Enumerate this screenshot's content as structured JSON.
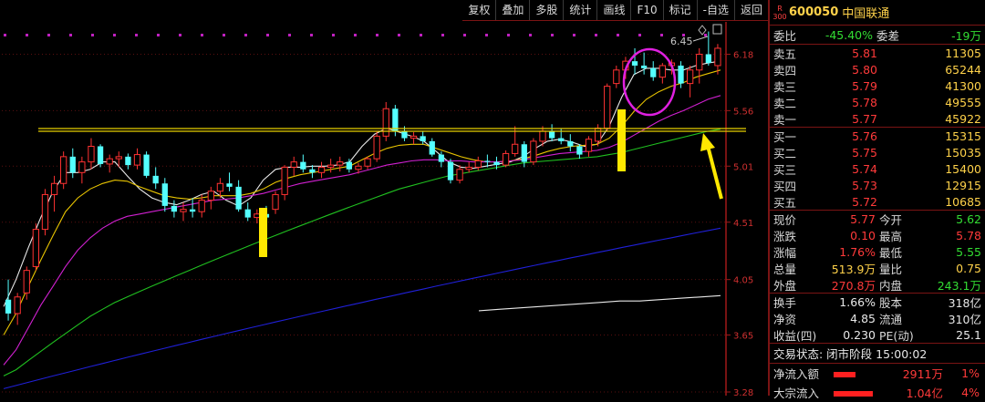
{
  "toolbar": {
    "buttons": [
      "复权",
      "叠加",
      "多股",
      "统计",
      "画线",
      "F10",
      "标记",
      "-自选",
      "返回"
    ]
  },
  "chart_data": {
    "type": "candlestick",
    "y_ticks": [
      "6.18",
      "5.56",
      "5.01",
      "4.51",
      "4.05",
      "3.65",
      "3.28"
    ],
    "peak_label": "6.45",
    "y_range": [
      3.28,
      6.5
    ],
    "candles": [
      {
        "o": 3.9,
        "h": 4.05,
        "l": 3.75,
        "c": 3.8
      },
      {
        "o": 3.8,
        "h": 3.95,
        "l": 3.72,
        "c": 3.92
      },
      {
        "o": 3.95,
        "h": 4.15,
        "l": 3.9,
        "c": 4.12
      },
      {
        "o": 4.15,
        "h": 4.5,
        "l": 4.12,
        "c": 4.45
      },
      {
        "o": 4.45,
        "h": 4.8,
        "l": 4.4,
        "c": 4.75
      },
      {
        "o": 4.75,
        "h": 4.92,
        "l": 4.6,
        "c": 4.85
      },
      {
        "o": 4.85,
        "h": 5.15,
        "l": 4.8,
        "c": 5.1
      },
      {
        "o": 5.1,
        "h": 5.18,
        "l": 4.9,
        "c": 4.95
      },
      {
        "o": 4.95,
        "h": 5.1,
        "l": 4.85,
        "c": 5.05
      },
      {
        "o": 5.05,
        "h": 5.28,
        "l": 4.98,
        "c": 5.2
      },
      {
        "o": 5.2,
        "h": 5.22,
        "l": 5.0,
        "c": 5.03
      },
      {
        "o": 5.03,
        "h": 5.12,
        "l": 4.95,
        "c": 5.08
      },
      {
        "o": 5.08,
        "h": 5.15,
        "l": 5.0,
        "c": 5.1
      },
      {
        "o": 5.1,
        "h": 5.13,
        "l": 4.98,
        "c": 5.02
      },
      {
        "o": 5.02,
        "h": 5.18,
        "l": 4.98,
        "c": 5.12
      },
      {
        "o": 5.12,
        "h": 5.15,
        "l": 4.9,
        "c": 4.92
      },
      {
        "o": 4.92,
        "h": 5.0,
        "l": 4.8,
        "c": 4.85
      },
      {
        "o": 4.85,
        "h": 4.9,
        "l": 4.6,
        "c": 4.65
      },
      {
        "o": 4.65,
        "h": 4.7,
        "l": 4.55,
        "c": 4.6
      },
      {
        "o": 4.6,
        "h": 4.68,
        "l": 4.52,
        "c": 4.62
      },
      {
        "o": 4.62,
        "h": 4.72,
        "l": 4.55,
        "c": 4.6
      },
      {
        "o": 4.6,
        "h": 4.75,
        "l": 4.55,
        "c": 4.7
      },
      {
        "o": 4.7,
        "h": 4.82,
        "l": 4.62,
        "c": 4.78
      },
      {
        "o": 4.78,
        "h": 4.9,
        "l": 4.72,
        "c": 4.85
      },
      {
        "o": 4.85,
        "h": 4.95,
        "l": 4.78,
        "c": 4.82
      },
      {
        "o": 4.82,
        "h": 4.88,
        "l": 4.6,
        "c": 4.62
      },
      {
        "o": 4.62,
        "h": 4.68,
        "l": 4.52,
        "c": 4.55
      },
      {
        "o": 4.55,
        "h": 4.62,
        "l": 4.5,
        "c": 4.58
      },
      {
        "o": 4.58,
        "h": 4.65,
        "l": 4.52,
        "c": 4.55
      },
      {
        "o": 4.62,
        "h": 4.78,
        "l": 4.58,
        "c": 4.75
      },
      {
        "o": 4.75,
        "h": 5.02,
        "l": 4.7,
        "c": 5.0
      },
      {
        "o": 5.0,
        "h": 5.1,
        "l": 4.92,
        "c": 5.05
      },
      {
        "o": 5.05,
        "h": 5.12,
        "l": 4.95,
        "c": 4.98
      },
      {
        "o": 4.98,
        "h": 5.02,
        "l": 4.9,
        "c": 4.95
      },
      {
        "o": 4.95,
        "h": 5.05,
        "l": 4.9,
        "c": 5.0
      },
      {
        "o": 5.0,
        "h": 5.08,
        "l": 4.95,
        "c": 5.02
      },
      {
        "o": 5.02,
        "h": 5.1,
        "l": 4.96,
        "c": 5.05
      },
      {
        "o": 5.05,
        "h": 5.08,
        "l": 4.95,
        "c": 4.98
      },
      {
        "o": 4.98,
        "h": 5.04,
        "l": 4.94,
        "c": 5.01
      },
      {
        "o": 5.01,
        "h": 5.1,
        "l": 4.98,
        "c": 5.08
      },
      {
        "o": 5.08,
        "h": 5.35,
        "l": 5.05,
        "c": 5.3
      },
      {
        "o": 5.3,
        "h": 5.65,
        "l": 5.25,
        "c": 5.58
      },
      {
        "o": 5.58,
        "h": 5.62,
        "l": 5.3,
        "c": 5.35
      },
      {
        "o": 5.35,
        "h": 5.4,
        "l": 5.25,
        "c": 5.28
      },
      {
        "o": 5.28,
        "h": 5.34,
        "l": 5.22,
        "c": 5.3
      },
      {
        "o": 5.3,
        "h": 5.35,
        "l": 5.22,
        "c": 5.25
      },
      {
        "o": 5.25,
        "h": 5.28,
        "l": 5.1,
        "c": 5.12
      },
      {
        "o": 5.12,
        "h": 5.15,
        "l": 5.0,
        "c": 5.05
      },
      {
        "o": 5.05,
        "h": 5.08,
        "l": 4.85,
        "c": 4.88
      },
      {
        "o": 4.88,
        "h": 5.02,
        "l": 4.85,
        "c": 4.98
      },
      {
        "o": 4.98,
        "h": 5.05,
        "l": 4.95,
        "c": 5.0
      },
      {
        "o": 5.0,
        "h": 5.1,
        "l": 4.97,
        "c": 5.06
      },
      {
        "o": 5.06,
        "h": 5.12,
        "l": 5.0,
        "c": 5.05
      },
      {
        "o": 5.05,
        "h": 5.1,
        "l": 4.98,
        "c": 5.02
      },
      {
        "o": 5.02,
        "h": 5.16,
        "l": 5.0,
        "c": 5.13
      },
      {
        "o": 5.13,
        "h": 5.4,
        "l": 5.1,
        "c": 5.22
      },
      {
        "o": 5.22,
        "h": 5.25,
        "l": 5.0,
        "c": 5.05
      },
      {
        "o": 5.05,
        "h": 5.28,
        "l": 5.02,
        "c": 5.25
      },
      {
        "o": 5.25,
        "h": 5.4,
        "l": 5.2,
        "c": 5.35
      },
      {
        "o": 5.35,
        "h": 5.42,
        "l": 5.25,
        "c": 5.28
      },
      {
        "o": 5.28,
        "h": 5.38,
        "l": 5.22,
        "c": 5.25
      },
      {
        "o": 5.25,
        "h": 5.32,
        "l": 5.15,
        "c": 5.2
      },
      {
        "o": 5.2,
        "h": 5.22,
        "l": 5.08,
        "c": 5.12
      },
      {
        "o": 5.15,
        "h": 5.3,
        "l": 5.1,
        "c": 5.27
      },
      {
        "o": 5.25,
        "h": 5.42,
        "l": 5.2,
        "c": 5.38
      },
      {
        "o": 5.38,
        "h": 5.85,
        "l": 5.35,
        "c": 5.82
      },
      {
        "o": 5.85,
        "h": 6.05,
        "l": 5.8,
        "c": 6.0
      },
      {
        "o": 6.0,
        "h": 6.15,
        "l": 5.9,
        "c": 6.1
      },
      {
        "o": 6.1,
        "h": 6.25,
        "l": 5.95,
        "c": 6.05
      },
      {
        "o": 6.05,
        "h": 6.2,
        "l": 5.95,
        "c": 6.02
      },
      {
        "o": 6.02,
        "h": 6.1,
        "l": 5.88,
        "c": 5.92
      },
      {
        "o": 5.92,
        "h": 6.08,
        "l": 5.85,
        "c": 6.05
      },
      {
        "o": 6.05,
        "h": 6.12,
        "l": 5.95,
        "c": 6.08
      },
      {
        "o": 6.05,
        "h": 6.1,
        "l": 5.8,
        "c": 5.85
      },
      {
        "o": 5.85,
        "h": 6.05,
        "l": 5.7,
        "c": 6.0
      },
      {
        "o": 6.0,
        "h": 6.25,
        "l": 5.85,
        "c": 6.18
      },
      {
        "o": 6.18,
        "h": 6.45,
        "l": 6.05,
        "c": 6.08
      },
      {
        "o": 6.05,
        "h": 6.3,
        "l": 5.95,
        "c": 6.25
      }
    ],
    "ma": [
      {
        "color": "#e8e8e8",
        "start": [
          3.8,
          3.75
        ],
        "pts": [
          3.85,
          4.05,
          4.3,
          4.55,
          4.78,
          4.95,
          4.95,
          4.98,
          5.05,
          5.05,
          4.92,
          4.8,
          4.72,
          4.68,
          4.66,
          4.7,
          4.75,
          4.78,
          4.7,
          4.65,
          4.72,
          4.88,
          4.98,
          5.0,
          5.0,
          5.01,
          5.01,
          5.02,
          5.05,
          5.2,
          5.32,
          5.38,
          5.34,
          5.3,
          5.25,
          5.15,
          5.05,
          5.0,
          4.99,
          5.01,
          5.03,
          5.05,
          5.1,
          5.18,
          5.25,
          5.27,
          5.24,
          5.2,
          5.22,
          5.4,
          5.7,
          5.95,
          6.02,
          6.02,
          6.0,
          6.0,
          6.05,
          6.08,
          6.1
        ]
      },
      {
        "color": "#e8c400",
        "pts": [
          3.65,
          3.8,
          4.0,
          4.2,
          4.4,
          4.6,
          4.72,
          4.8,
          4.85,
          4.88,
          4.87,
          4.82,
          4.78,
          4.74,
          4.72,
          4.71,
          4.72,
          4.74,
          4.74,
          4.74,
          4.76,
          4.8,
          4.86,
          4.9,
          4.93,
          4.95,
          4.97,
          4.99,
          5.01,
          5.07,
          5.13,
          5.18,
          5.21,
          5.22,
          5.22,
          5.18,
          5.14,
          5.1,
          5.07,
          5.05,
          5.05,
          5.06,
          5.08,
          5.11,
          5.15,
          5.18,
          5.2,
          5.21,
          5.22,
          5.28,
          5.4,
          5.55,
          5.68,
          5.76,
          5.82,
          5.86,
          5.92,
          5.96,
          6.0
        ]
      },
      {
        "color": "#d020d0",
        "pts": [
          3.45,
          3.55,
          3.7,
          3.86,
          4.0,
          4.15,
          4.28,
          4.38,
          4.46,
          4.52,
          4.56,
          4.58,
          4.6,
          4.62,
          4.64,
          4.66,
          4.68,
          4.7,
          4.71,
          4.72,
          4.74,
          4.76,
          4.79,
          4.82,
          4.85,
          4.87,
          4.89,
          4.91,
          4.93,
          4.96,
          4.99,
          5.02,
          5.04,
          5.06,
          5.07,
          5.07,
          5.06,
          5.06,
          5.05,
          5.05,
          5.05,
          5.06,
          5.07,
          5.09,
          5.11,
          5.13,
          5.14,
          5.15,
          5.16,
          5.19,
          5.24,
          5.31,
          5.38,
          5.45,
          5.51,
          5.56,
          5.62,
          5.68,
          5.72
        ]
      },
      {
        "color": "#20c020",
        "pts": [
          3.38,
          3.42,
          3.48,
          3.54,
          3.6,
          3.66,
          3.72,
          3.78,
          3.83,
          3.88,
          3.92,
          3.96,
          4.0,
          4.04,
          4.08,
          4.12,
          4.16,
          4.2,
          4.24,
          4.28,
          4.32,
          4.36,
          4.4,
          4.44,
          4.48,
          4.52,
          4.56,
          4.6,
          4.64,
          4.68,
          4.72,
          4.76,
          4.8,
          4.83,
          4.86,
          4.89,
          4.92,
          4.94,
          4.96,
          4.98,
          5.0,
          5.02,
          5.04,
          5.05,
          5.06,
          5.07,
          5.08,
          5.09,
          5.1,
          5.12,
          5.14,
          5.17,
          5.2,
          5.23,
          5.26,
          5.29,
          5.32,
          5.35,
          5.37
        ]
      },
      {
        "color": "#2020d8",
        "pts": [
          3.3,
          3.32,
          3.34,
          3.36,
          3.38,
          3.4,
          3.42,
          3.44,
          3.46,
          3.48,
          3.5,
          3.52,
          3.54,
          3.56,
          3.58,
          3.6,
          3.62,
          3.64,
          3.66,
          3.68,
          3.7,
          3.72,
          3.74,
          3.76,
          3.78,
          3.8,
          3.82,
          3.84,
          3.86,
          3.88,
          3.9,
          3.92,
          3.94,
          3.96,
          3.98,
          4.0,
          4.02,
          4.04,
          4.06,
          4.08,
          4.1,
          4.12,
          4.14,
          4.16,
          4.18,
          4.2,
          4.22,
          4.24,
          4.26,
          4.28,
          4.3,
          4.32,
          4.34,
          4.36,
          4.38,
          4.4,
          4.42,
          4.44,
          4.46
        ]
      },
      {
        "color": "#e8e8e8",
        "start": [
          3.82,
          3.8
        ],
        "pts": [
          3.82,
          3.83,
          3.84,
          3.85,
          3.86,
          3.87,
          3.88,
          3.89,
          3.89,
          3.9,
          3.91,
          3.92,
          3.93
        ]
      }
    ]
  },
  "quote": {
    "badge_r": "R",
    "badge_num": "300",
    "code": "600050",
    "name": "中国联通",
    "weibi_label": "委比",
    "weibi_value": "-45.40%",
    "weicha_label": "委差",
    "weicha_value": "-19万",
    "asks": [
      {
        "label": "卖五",
        "price": "5.81",
        "vol": "11305"
      },
      {
        "label": "卖四",
        "price": "5.80",
        "vol": "65244"
      },
      {
        "label": "卖三",
        "price": "5.79",
        "vol": "41300"
      },
      {
        "label": "卖二",
        "price": "5.78",
        "vol": "49555"
      },
      {
        "label": "卖一",
        "price": "5.77",
        "vol": "45922"
      }
    ],
    "bids": [
      {
        "label": "买一",
        "price": "5.76",
        "vol": "15315"
      },
      {
        "label": "买二",
        "price": "5.75",
        "vol": "15035"
      },
      {
        "label": "买三",
        "price": "5.74",
        "vol": "15400"
      },
      {
        "label": "买四",
        "price": "5.73",
        "vol": "12915"
      },
      {
        "label": "买五",
        "price": "5.72",
        "vol": "10685"
      }
    ],
    "stats": [
      {
        "l1": "现价",
        "v1": "5.77",
        "c1": "red",
        "l2": "今开",
        "v2": "5.62",
        "c2": "green"
      },
      {
        "l1": "涨跌",
        "v1": "0.10",
        "c1": "red",
        "l2": "最高",
        "v2": "5.78",
        "c2": "red"
      },
      {
        "l1": "涨幅",
        "v1": "1.76%",
        "c1": "red",
        "l2": "最低",
        "v2": "5.55",
        "c2": "green"
      },
      {
        "l1": "总量",
        "v1": "513.9万",
        "c1": "yellow",
        "l2": "量比",
        "v2": "0.75",
        "c2": "yellow"
      },
      {
        "l1": "外盘",
        "v1": "270.8万",
        "c1": "red",
        "l2": "内盘",
        "v2": "243.1万",
        "c2": "green"
      }
    ],
    "stats2": [
      {
        "l1": "换手",
        "v1": "1.66%",
        "l2": "股本",
        "v2": "318亿"
      },
      {
        "l1": "净资",
        "v1": "4.85",
        "l2": "流通",
        "v2": "310亿"
      },
      {
        "l1": "收益(四)",
        "v1": "0.230",
        "l2": "PE(动)",
        "v2": "25.1"
      }
    ],
    "trade_status": "交易状态: 闭市阶段 15:00:02",
    "flow1": {
      "label": "净流入额",
      "value": "2911万",
      "pct": "1%",
      "bar": 0.4
    },
    "flow2": {
      "label": "大宗流入",
      "value": "1.04亿",
      "pct": "4%",
      "bar": 0.72
    }
  }
}
